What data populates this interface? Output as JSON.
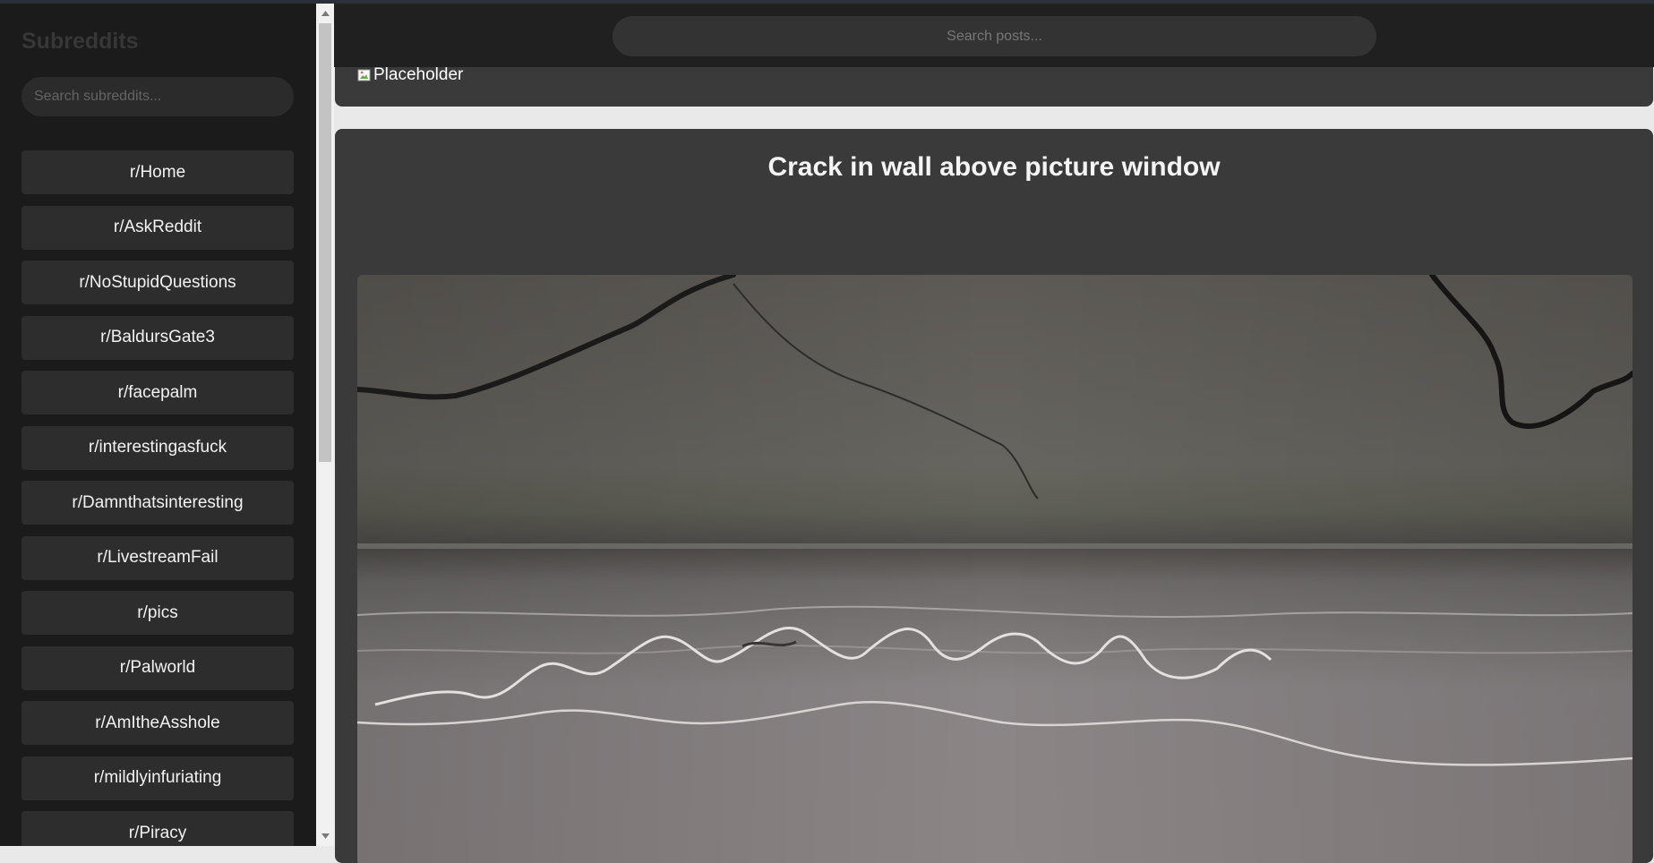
{
  "sidebar": {
    "title": "Subreddits",
    "search_placeholder": "Search subreddits...",
    "items": [
      {
        "label": "r/Home"
      },
      {
        "label": "r/AskReddit"
      },
      {
        "label": "r/NoStupidQuestions"
      },
      {
        "label": "r/BaldursGate3"
      },
      {
        "label": "r/facepalm"
      },
      {
        "label": "r/interestingasfuck"
      },
      {
        "label": "r/Damnthatsinteresting"
      },
      {
        "label": "r/LivestreamFail"
      },
      {
        "label": "r/pics"
      },
      {
        "label": "r/Palworld"
      },
      {
        "label": "r/AmItheAsshole"
      },
      {
        "label": "r/mildlyinfuriating"
      },
      {
        "label": "r/Piracy"
      }
    ]
  },
  "header": {
    "search_placeholder": "Search posts..."
  },
  "posts": [
    {
      "image_alt": "Placeholder"
    },
    {
      "title": "Crack in wall above picture window"
    }
  ],
  "colors": {
    "sidebar_bg": "#1b1b1b",
    "card_bg": "#3a3a3a",
    "header_bg": "#202020",
    "button_bg": "#2d2d2d"
  },
  "icons": {
    "scroll_up": "triangle-up-icon",
    "scroll_down": "triangle-down-icon",
    "broken_image": "broken-image-icon"
  }
}
